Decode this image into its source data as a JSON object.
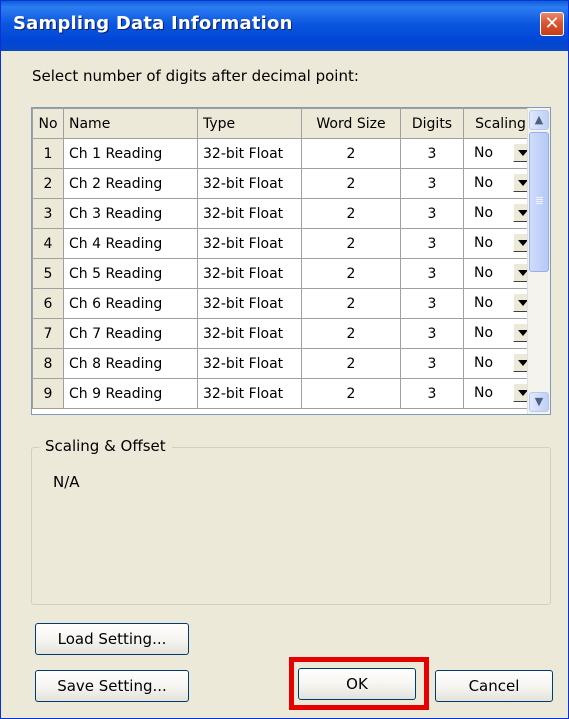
{
  "window": {
    "title": "Sampling Data Information",
    "close_glyph": "✕"
  },
  "prompt": "Select number of digits after decimal point:",
  "columns": {
    "no": "No",
    "name": "Name",
    "type": "Type",
    "word_size": "Word Size",
    "digits": "Digits",
    "scaling": "Scaling"
  },
  "rows": [
    {
      "no": "1",
      "name": "Ch 1 Reading",
      "type": "32-bit Float",
      "word_size": "2",
      "digits": "3",
      "scaling": "No"
    },
    {
      "no": "2",
      "name": "Ch 2 Reading",
      "type": "32-bit Float",
      "word_size": "2",
      "digits": "3",
      "scaling": "No"
    },
    {
      "no": "3",
      "name": "Ch 3 Reading",
      "type": "32-bit Float",
      "word_size": "2",
      "digits": "3",
      "scaling": "No"
    },
    {
      "no": "4",
      "name": "Ch 4 Reading",
      "type": "32-bit Float",
      "word_size": "2",
      "digits": "3",
      "scaling": "No"
    },
    {
      "no": "5",
      "name": "Ch 5 Reading",
      "type": "32-bit Float",
      "word_size": "2",
      "digits": "3",
      "scaling": "No"
    },
    {
      "no": "6",
      "name": "Ch 6 Reading",
      "type": "32-bit Float",
      "word_size": "2",
      "digits": "3",
      "scaling": "No"
    },
    {
      "no": "7",
      "name": "Ch 7 Reading",
      "type": "32-bit Float",
      "word_size": "2",
      "digits": "3",
      "scaling": "No"
    },
    {
      "no": "8",
      "name": "Ch 8 Reading",
      "type": "32-bit Float",
      "word_size": "2",
      "digits": "3",
      "scaling": "No"
    },
    {
      "no": "9",
      "name": "Ch 9 Reading",
      "type": "32-bit Float",
      "word_size": "2",
      "digits": "3",
      "scaling": "No"
    }
  ],
  "scaling_offset": {
    "title": "Scaling & Offset",
    "value": "N/A"
  },
  "buttons": {
    "load": "Load Setting...",
    "save": "Save Setting...",
    "ok": "OK",
    "cancel": "Cancel"
  },
  "icons": {
    "close": "close-icon",
    "dropdown": "chevron-down-icon",
    "scroll_up": "chevron-up-icon",
    "scroll_down": "chevron-down-icon"
  },
  "colors": {
    "title_bar": "#0058e6",
    "close_button": "#d9562f",
    "dialog_bg": "#ece9d8",
    "highlight": "#e60000"
  }
}
